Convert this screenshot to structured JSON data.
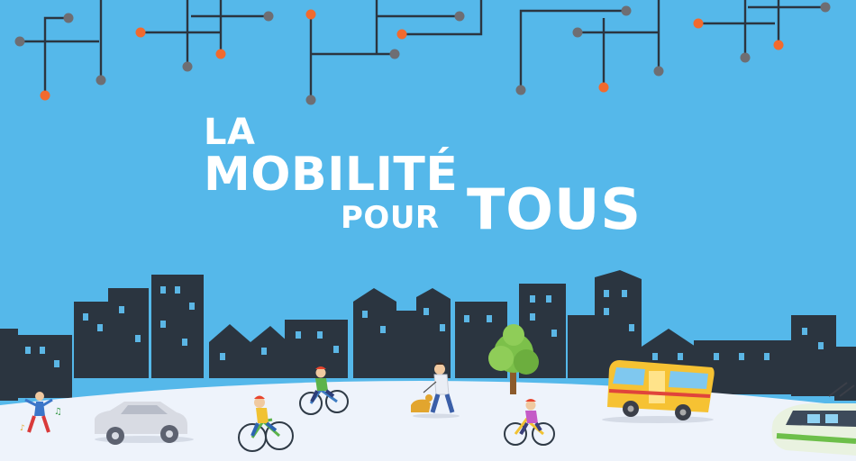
{
  "headline": {
    "line1": "LA",
    "line2": "MOBILITÉ",
    "line3": "POUR",
    "line4": "TOUS"
  },
  "colors": {
    "sky": "#55b8ea",
    "skyline": "#2b3540",
    "ground": "#eef3fb",
    "circuit_line": "#2b3540",
    "circuit_node_grey": "#6e6e73",
    "circuit_node_orange": "#f26a2e",
    "headline_text": "#ffffff",
    "bus": "#f6c233",
    "car": "#d8dbe3",
    "tram": "#e9f2e0",
    "tree": "#7cc04a"
  },
  "icons": [
    "circuit-network",
    "city-skyline",
    "dancer-icon",
    "car-icon",
    "cyclist-icon",
    "dog-walker-icon",
    "tree-icon",
    "bus-icon",
    "tram-icon"
  ]
}
